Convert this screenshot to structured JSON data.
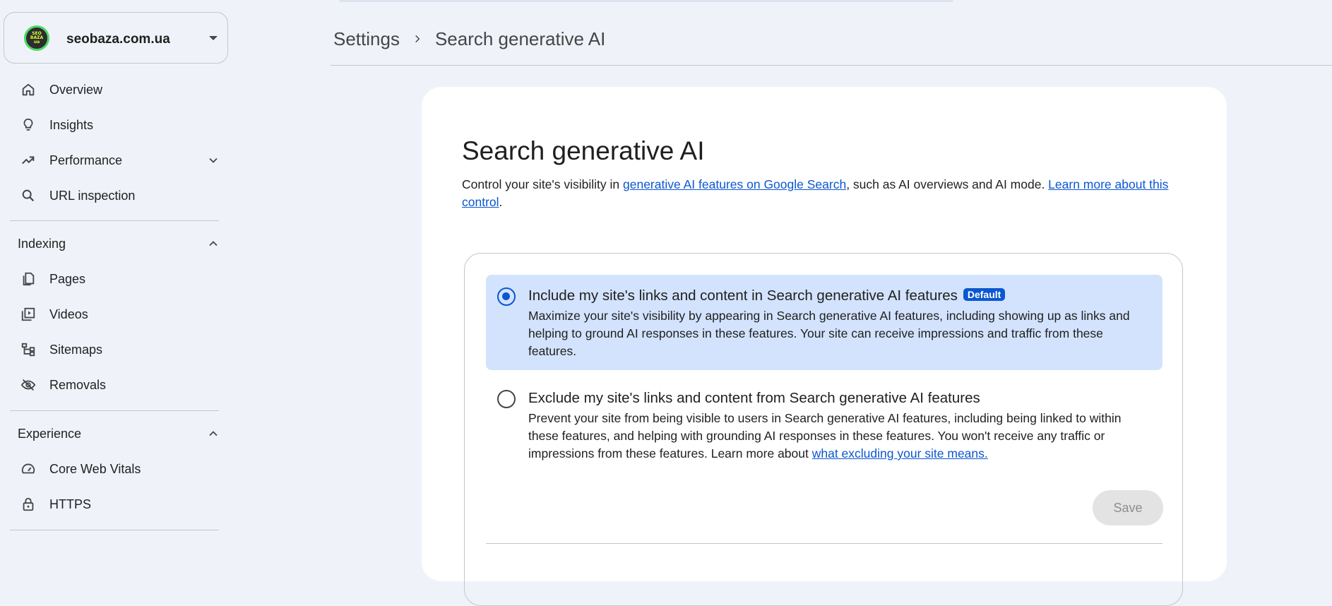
{
  "property": {
    "name": "seobaza.com.ua",
    "favicon_text": [
      "SEO",
      "BAZA",
      "ua"
    ]
  },
  "sidebar": {
    "items": [
      {
        "label": "Overview",
        "icon": "home-icon"
      },
      {
        "label": "Insights",
        "icon": "lightbulb-icon"
      },
      {
        "label": "Performance",
        "icon": "trending-up-icon"
      },
      {
        "label": "URL inspection",
        "icon": "search-icon"
      }
    ],
    "sections": [
      {
        "label": "Indexing",
        "items": [
          {
            "label": "Pages",
            "icon": "pages-icon"
          },
          {
            "label": "Videos",
            "icon": "video-library-icon"
          },
          {
            "label": "Sitemaps",
            "icon": "sitemap-icon"
          },
          {
            "label": "Removals",
            "icon": "visibility-off-icon"
          }
        ]
      },
      {
        "label": "Experience",
        "items": [
          {
            "label": "Core Web Vitals",
            "icon": "speed-icon"
          },
          {
            "label": "HTTPS",
            "icon": "lock-icon"
          }
        ]
      }
    ]
  },
  "breadcrumb": {
    "parent": "Settings",
    "current": "Search generative AI"
  },
  "main": {
    "title": "Search generative AI",
    "desc_prefix": "Control your site's visibility in ",
    "desc_link1": "generative AI features on Google Search",
    "desc_middle": ", such as AI overviews and AI mode. ",
    "desc_link2": "Learn more about this control",
    "desc_suffix": ".",
    "options": [
      {
        "title": "Include my site's links and content in Search generative AI features",
        "badge": "Default",
        "desc": "Maximize your site's visibility by appearing in Search generative AI features, including showing up as links and helping to ground AI responses in these features. Your site can receive impressions and traffic from these features.",
        "selected": true
      },
      {
        "title": "Exclude my site's links and content from Search generative AI features",
        "desc": "Prevent your site from being visible to users in Search generative AI features, including being linked to within these features, and helping with grounding AI responses in these features. You won't receive any traffic or impressions from these features. Learn more about ",
        "desc_link": "what excluding your site means.",
        "selected": false
      }
    ],
    "save_label": "Save"
  },
  "colors": {
    "accent": "#0b57d0",
    "selected_bg": "#d3e3fd",
    "page_bg": "#eff3f9"
  }
}
